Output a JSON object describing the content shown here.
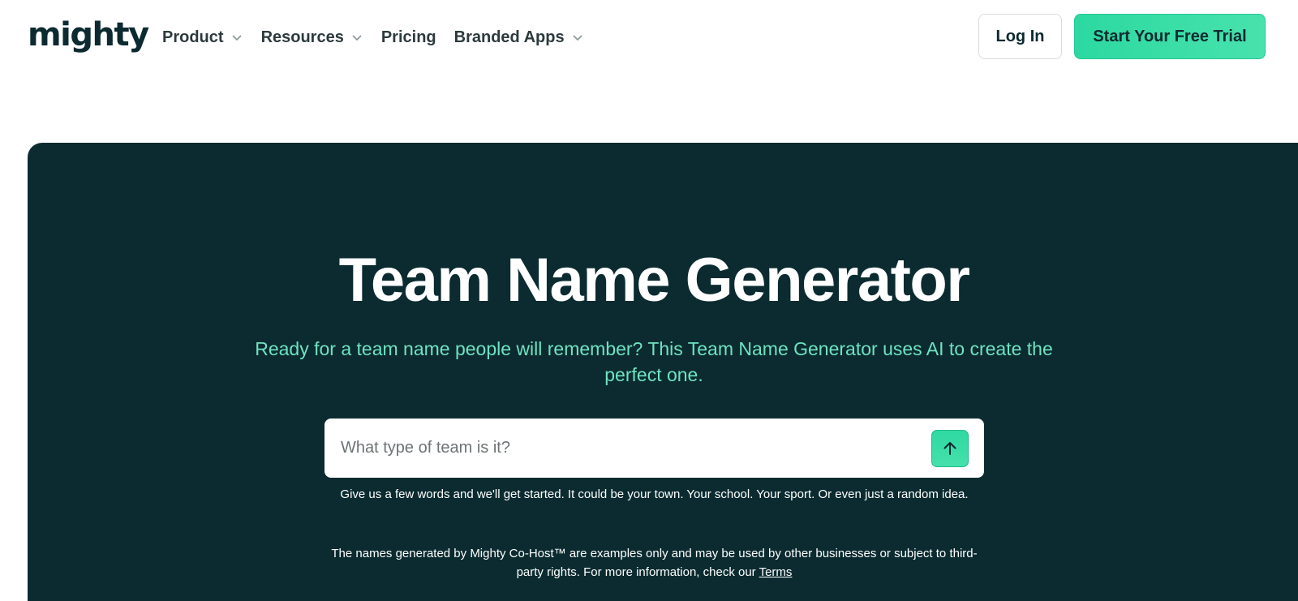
{
  "header": {
    "logo": "mighty",
    "nav": [
      {
        "label": "Product",
        "has_dropdown": true
      },
      {
        "label": "Resources",
        "has_dropdown": true
      },
      {
        "label": "Pricing",
        "has_dropdown": false
      },
      {
        "label": "Branded Apps",
        "has_dropdown": true
      }
    ],
    "login_label": "Log In",
    "trial_label": "Start Your Free Trial"
  },
  "hero": {
    "title": "Team Name Generator",
    "subtitle": "Ready for a team name people will remember? This Team Name Generator uses AI to create the perfect one.",
    "input_placeholder": "What type of team is it?",
    "input_value": "",
    "submit_icon": "arrow-up-icon",
    "hint": "Give us a few words and we'll get started. It could be your town. Your school. Your sport. Or even just a random idea.",
    "disclaimer_text": "The names generated by Mighty Co-Host™ are examples only and may be used by other businesses or subject to third-party rights. For more information, check our",
    "terms_label": "Terms"
  },
  "colors": {
    "hero_bg": "#0b2b30",
    "accent": "#2cd9a0",
    "subtitle": "#6fe3c0",
    "text_dark": "#0c2a30"
  }
}
